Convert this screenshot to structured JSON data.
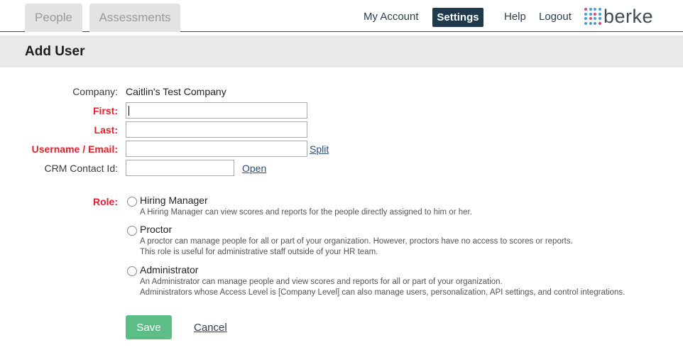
{
  "nav": {
    "tabs": [
      {
        "label": "People"
      },
      {
        "label": "Assessments"
      }
    ],
    "links": {
      "my_account": "My Account",
      "settings": "Settings",
      "help": "Help",
      "logout": "Logout"
    },
    "logo_text": "berke"
  },
  "page": {
    "title": "Add User"
  },
  "form": {
    "company_label": "Company:",
    "company_value": "Caitlin's Test Company",
    "first_label": "First:",
    "first_value": "",
    "last_label": "Last:",
    "last_value": "",
    "username_label": "Username / Email:",
    "username_value": "",
    "split_link": "Split",
    "crm_label": "CRM Contact Id:",
    "crm_value": "",
    "open_link": "Open",
    "role_label": "Role:",
    "roles": [
      {
        "title": "Hiring Manager",
        "desc": [
          "A Hiring Manager can view scores and reports for the people directly assigned to him or her."
        ]
      },
      {
        "title": "Proctor",
        "desc": [
          "A proctor can manage people for all or part of your organization. However, proctors have no access to scores or reports.",
          "This role is useful for administrative staff outside of your HR team."
        ]
      },
      {
        "title": "Administrator",
        "desc": [
          "An Administrator can manage people and view scores and reports for all or part of your organization.",
          "Administrators whose Access Level is [Company Level] can also manage users, personalization, API settings, and control integrations."
        ]
      }
    ]
  },
  "actions": {
    "save": "Save",
    "cancel": "Cancel"
  },
  "colors": {
    "required_label": "#e0202c",
    "settings_bg": "#1f3a4d",
    "save_bg": "#5cbd86"
  }
}
